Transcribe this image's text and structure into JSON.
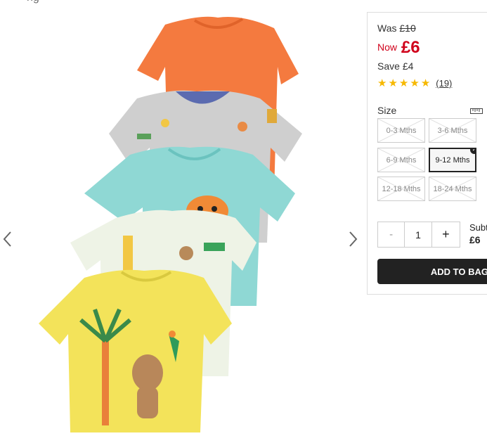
{
  "top_text": "ng",
  "pricing": {
    "was_label": "Was",
    "was_price": "£10",
    "now_label": "Now",
    "now_price": "£6",
    "save_label": "Save",
    "save_amount": "£4"
  },
  "rating": {
    "stars": 5,
    "count": "(19)"
  },
  "size": {
    "label": "Size",
    "options": [
      {
        "label": "0-3 Mths",
        "available": false,
        "selected": false
      },
      {
        "label": "3-6 Mths",
        "available": false,
        "selected": false
      },
      {
        "label": "6-9 Mths",
        "available": false,
        "selected": false
      },
      {
        "label": "9-12 Mths",
        "available": true,
        "selected": true
      },
      {
        "label": "12-18 Mths",
        "available": false,
        "selected": false
      },
      {
        "label": "18-24 Mths",
        "available": false,
        "selected": false
      }
    ]
  },
  "quantity": {
    "minus": "-",
    "value": "1",
    "plus": "+"
  },
  "subtotal": {
    "label": "Subt",
    "amount": "£6"
  },
  "add_to_bag": "ADD TO BAG",
  "colors": {
    "accent_red": "#d0021b",
    "star": "#f6b800",
    "button": "#222222"
  },
  "icons": {
    "prev": "chevron-left-icon",
    "next": "chevron-right-icon",
    "size_guide": "ruler-icon",
    "check": "check-icon"
  }
}
